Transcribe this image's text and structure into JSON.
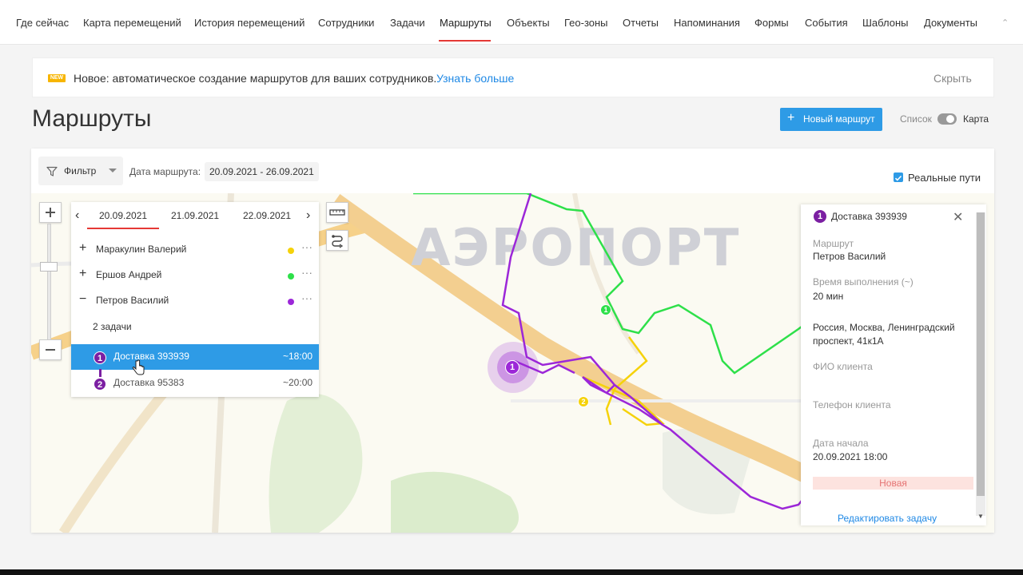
{
  "nav": {
    "items": [
      "Где сейчас",
      "Карта перемещений",
      "История перемещений",
      "Сотрудники",
      "Задачи",
      "Маршруты",
      "Объекты",
      "Гео-зоны",
      "Отчеты",
      "Напоминания",
      "Формы",
      "События",
      "Шаблоны",
      "Документы"
    ],
    "active": "Маршруты",
    "active_color": "#e53935"
  },
  "banner": {
    "badge": "NEW",
    "text": "Новое: автоматическое создание маршрутов для ваших сотрудников.",
    "link": "Узнать больше",
    "hide": "Скрыть"
  },
  "page": {
    "title": "Маршруты",
    "new_route_button": "Новый маршрут",
    "view_list": "Список",
    "view_map": "Карта",
    "accent": "#2e9be6"
  },
  "filter": {
    "label": "Фильтр",
    "date_label": "Дата маршрута:",
    "date_value": "20.09.2021 - 26.09.2021",
    "real_paths": "Реальные пути",
    "real_paths_checked": true
  },
  "map": {
    "label": "АЭРОПОРТ"
  },
  "route_panel": {
    "dates": [
      "20.09.2021",
      "21.09.2021",
      "22.09.2021"
    ],
    "active_date": "20.09.2021",
    "employees": [
      {
        "name": "Маракулин Валерий",
        "color": "#f5d20a",
        "expanded": false
      },
      {
        "name": "Ершов Андрей",
        "color": "#2ee04a",
        "expanded": false
      },
      {
        "name": "Петров Василий",
        "color": "#9c27d8",
        "expanded": true
      }
    ],
    "tasks_count": "2 задачи",
    "tasks": [
      {
        "num": "1",
        "name": "Доставка 393939",
        "time": "~18:00",
        "selected": true
      },
      {
        "num": "2",
        "name": "Доставка 95383",
        "time": "~20:00",
        "selected": false
      }
    ]
  },
  "map_markers": [
    {
      "num": "1",
      "color": "#9c27d8"
    },
    {
      "num": "2",
      "color": "#f5d20a"
    },
    {
      "num": "1",
      "color": "#2ee04a"
    }
  ],
  "detail": {
    "num": "1",
    "title": "Доставка 393939",
    "route_label": "Маршрут",
    "route_value": "Петров Василий",
    "time_label": "Время выполнения (~)",
    "time_value": "20 мин",
    "address": "Россия, Москва, Ленинградский проспект, 41к1А",
    "client_name_label": "ФИО клиента",
    "client_phone_label": "Телефон клиента",
    "start_label": "Дата начала",
    "start_value": "20.09.2021 18:00",
    "status": "Новая",
    "edit": "Редактировать задачу"
  }
}
